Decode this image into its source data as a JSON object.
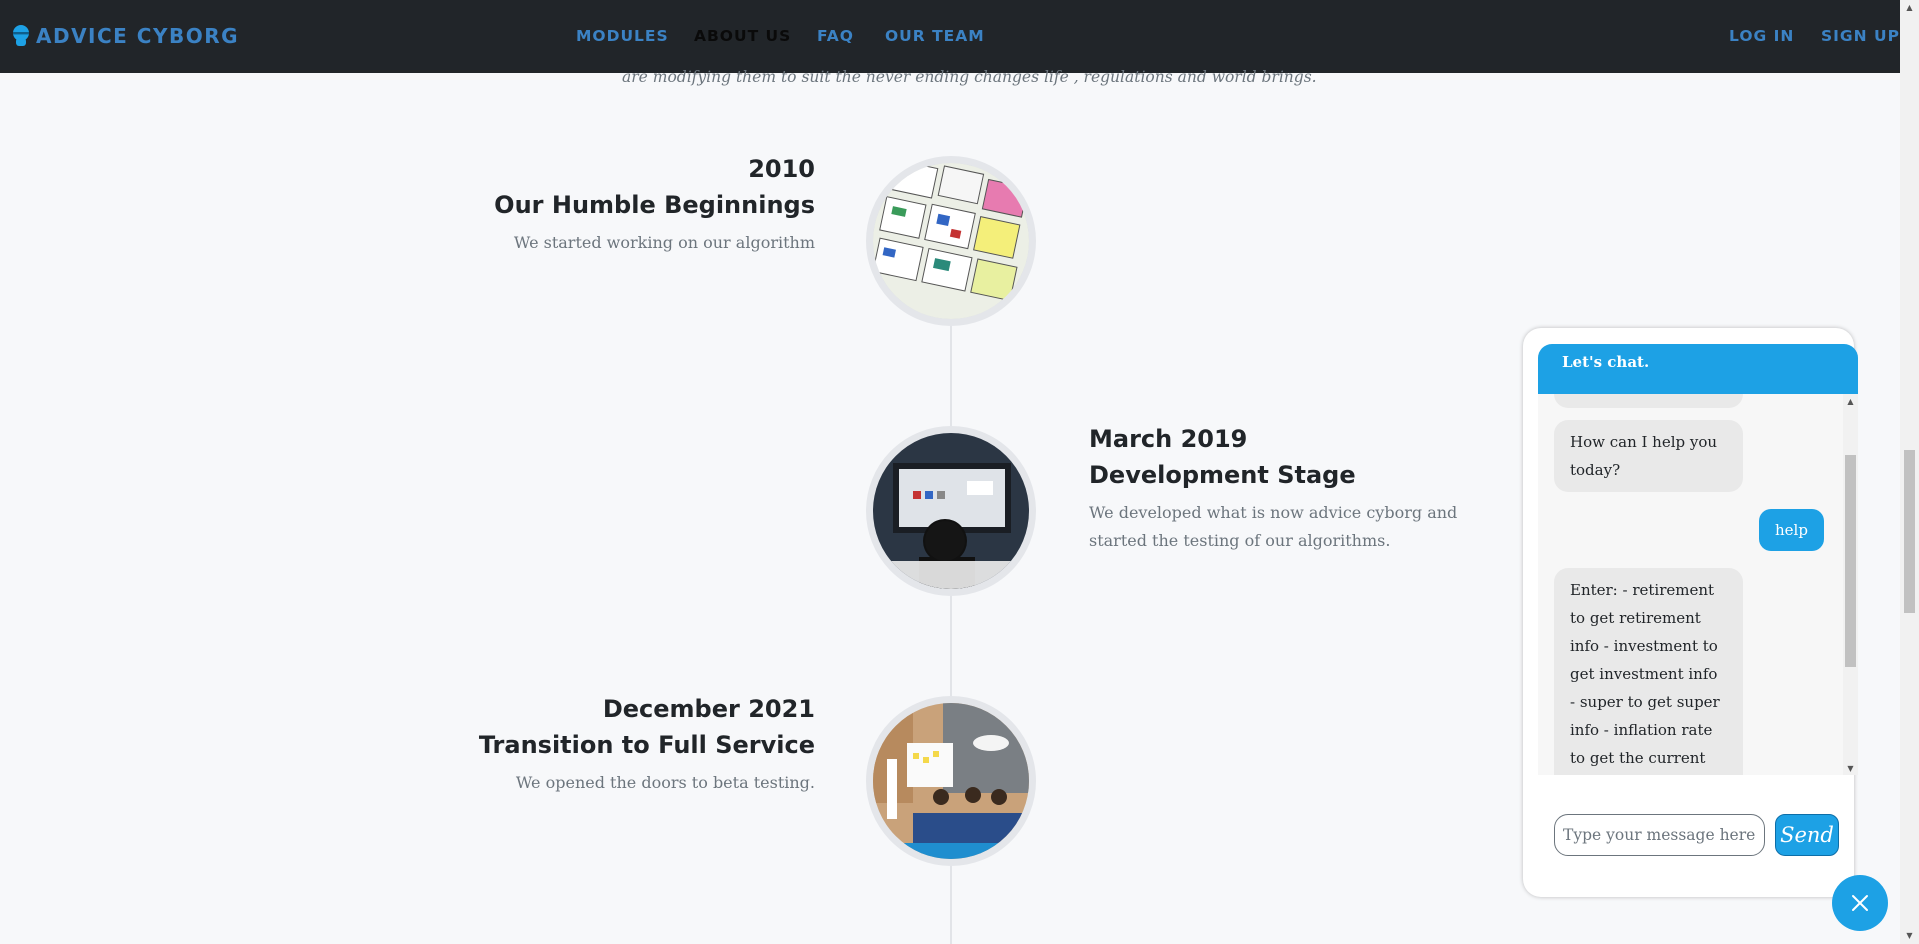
{
  "brand": {
    "name": "ADVICE CYBORG",
    "icon": "cyborg-head-icon"
  },
  "nav": {
    "items": [
      {
        "label": "MODULES",
        "active": false
      },
      {
        "label": "ABOUT US",
        "active": true
      },
      {
        "label": "FAQ",
        "active": false
      },
      {
        "label": "OUR TEAM",
        "active": false
      }
    ],
    "login_label": "LOG IN",
    "signup_label": "SIGN UP"
  },
  "intro_text": "are modifying them to suit the never ending changes life , regulations and world brings.",
  "timeline": [
    {
      "date": "2010",
      "title": "Our Humble Beginnings",
      "description": "We started working on our algorithm",
      "image": "wireframe-sketches"
    },
    {
      "date": "March 2019",
      "title": "Development Stage",
      "description": "We developed what is now advice cyborg and started the testing of our algorithms.",
      "image": "developer-at-monitor"
    },
    {
      "date": "December 2021",
      "title": "Transition to Full Service",
      "description": "We opened the doors to beta testing.",
      "image": "team-meeting"
    }
  ],
  "chat": {
    "header": "Let's chat.",
    "messages": [
      {
        "from": "bot",
        "text": "How can I help you today?"
      },
      {
        "from": "user",
        "text": "help"
      },
      {
        "from": "bot",
        "text": "Enter: - retirement to get retirement info - investment to get investment info - super to get super info - inflation rate to get the current inflation rate"
      }
    ],
    "input_placeholder": "Type your message here...",
    "send_label": "Send",
    "close_icon": "close-icon"
  },
  "colors": {
    "navbar": "#212529",
    "accent": "#1da1e5",
    "nav_link": "#3b82c4",
    "background": "#f7f8fa"
  }
}
